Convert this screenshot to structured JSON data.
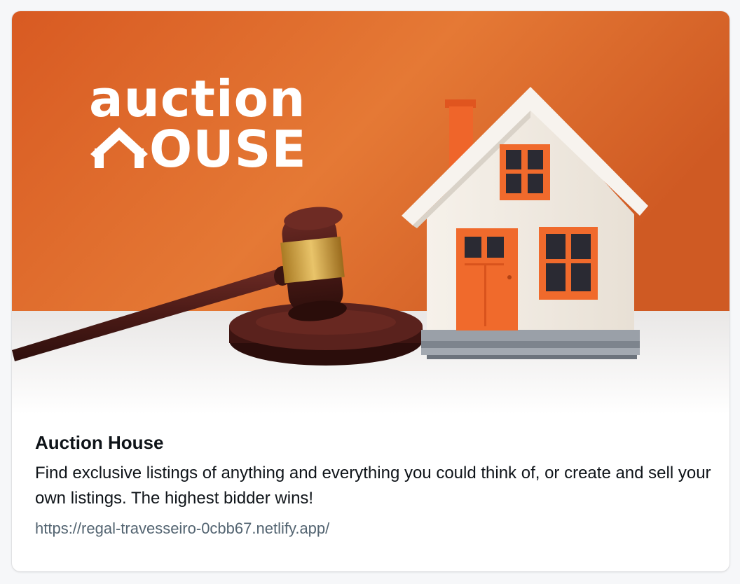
{
  "card": {
    "title": "Auction House",
    "description": "Find exclusive listings of anything and everything you could think of, or create and sell your own listings. The highest bidder wins!",
    "url": "https://regal-travesseiro-0cbb67.netlify.app/"
  },
  "hero": {
    "logo_text_top": "auction",
    "logo_text_bottom": "OUSE",
    "icons": [
      "gavel-icon",
      "house-icon"
    ],
    "colors": {
      "background_orange": "#e2692a",
      "table_white": "#f1f1f1",
      "gavel_brown": "#4a1c18",
      "house_orange": "#f06a2c",
      "window_dark": "#2a2a33"
    }
  }
}
